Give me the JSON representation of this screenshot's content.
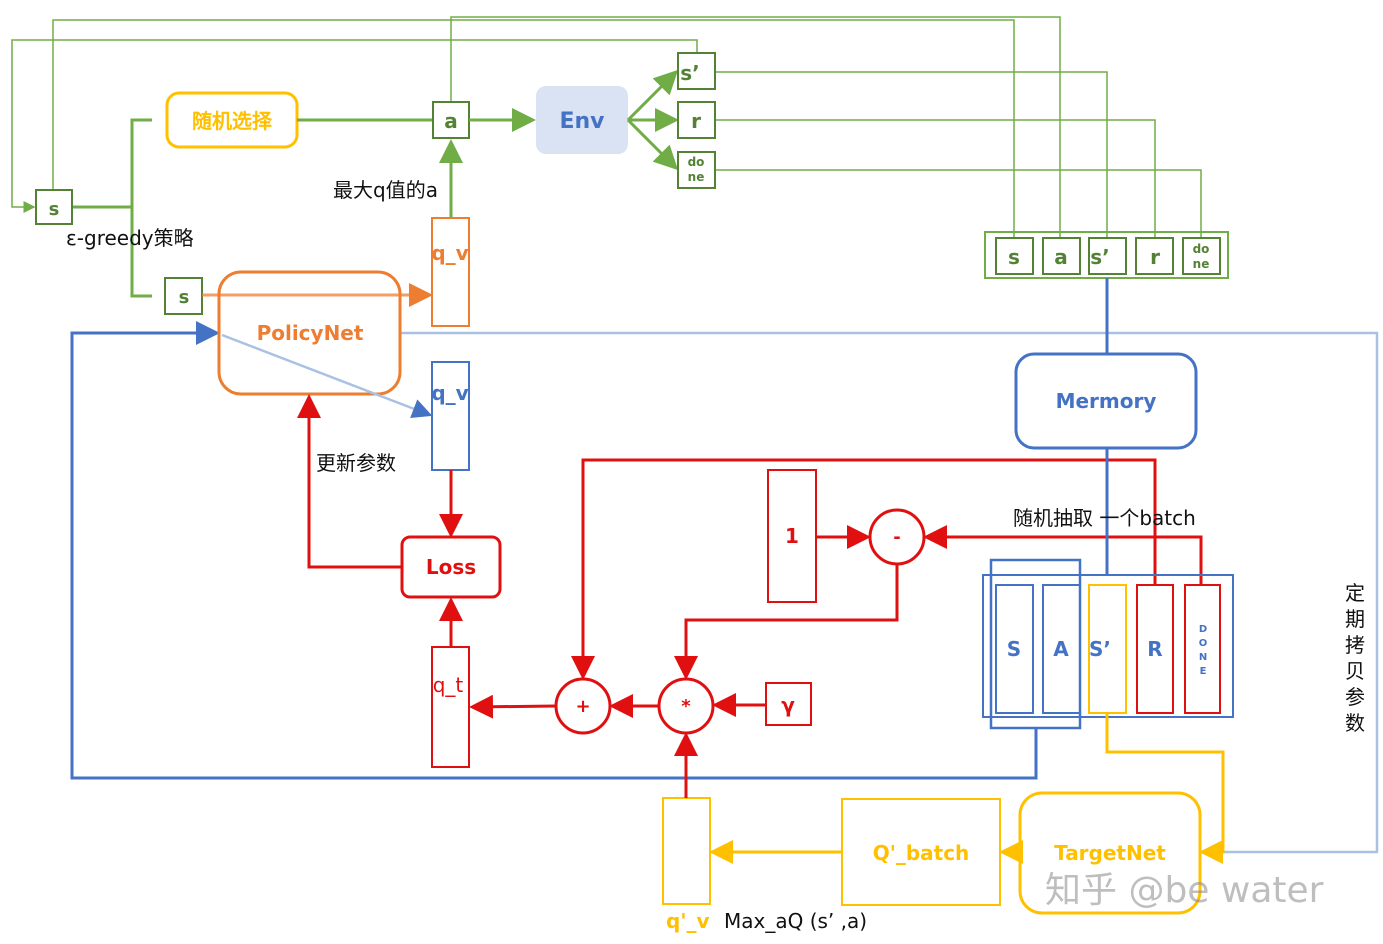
{
  "colors": {
    "green": "#70ad47",
    "dark_green": "#548235",
    "orange": "#ed7d31",
    "blue": "#4472c4",
    "light_blue": "#a9c1e3",
    "env_fill": "#dae3f3",
    "red": "#e01010",
    "yellow": "#ffc000"
  },
  "nodes": {
    "s_input": "s",
    "random_select": "随机选择",
    "action": "a",
    "env": "Env",
    "s_prime": "s’",
    "reward": "r",
    "done_line1": "do",
    "done_line2": "ne",
    "s_policy": "s",
    "q_v_orange": "q_v",
    "policy_net": "PolicyNet",
    "q_v_blue": "q_v",
    "loss": "Loss",
    "q_t": "q_t",
    "plus": "+",
    "times": "*",
    "minus": "-",
    "one": "1",
    "gamma": "γ",
    "memory": "Mermory",
    "target_net": "TargetNet",
    "q_batch": "Q'_batch",
    "q_prime_v": "q'_v"
  },
  "memory_tuple": [
    "s",
    "a",
    "s’",
    "r",
    "do",
    "ne"
  ],
  "batch": [
    "S",
    "A",
    "S’",
    "R",
    "D",
    "O",
    "N",
    "E"
  ],
  "labels": {
    "max_q_action": "最大q值的a",
    "epsilon_greedy": "ε-greedy策略",
    "update_params": "更新参数",
    "sample_batch": "随机抽取  一个batch",
    "copy_params": [
      "定",
      "期",
      "拷",
      "贝",
      "参",
      "数"
    ],
    "max_formula": "Max_aQ (s’  ,a)"
  },
  "watermark": "知乎 @be water"
}
